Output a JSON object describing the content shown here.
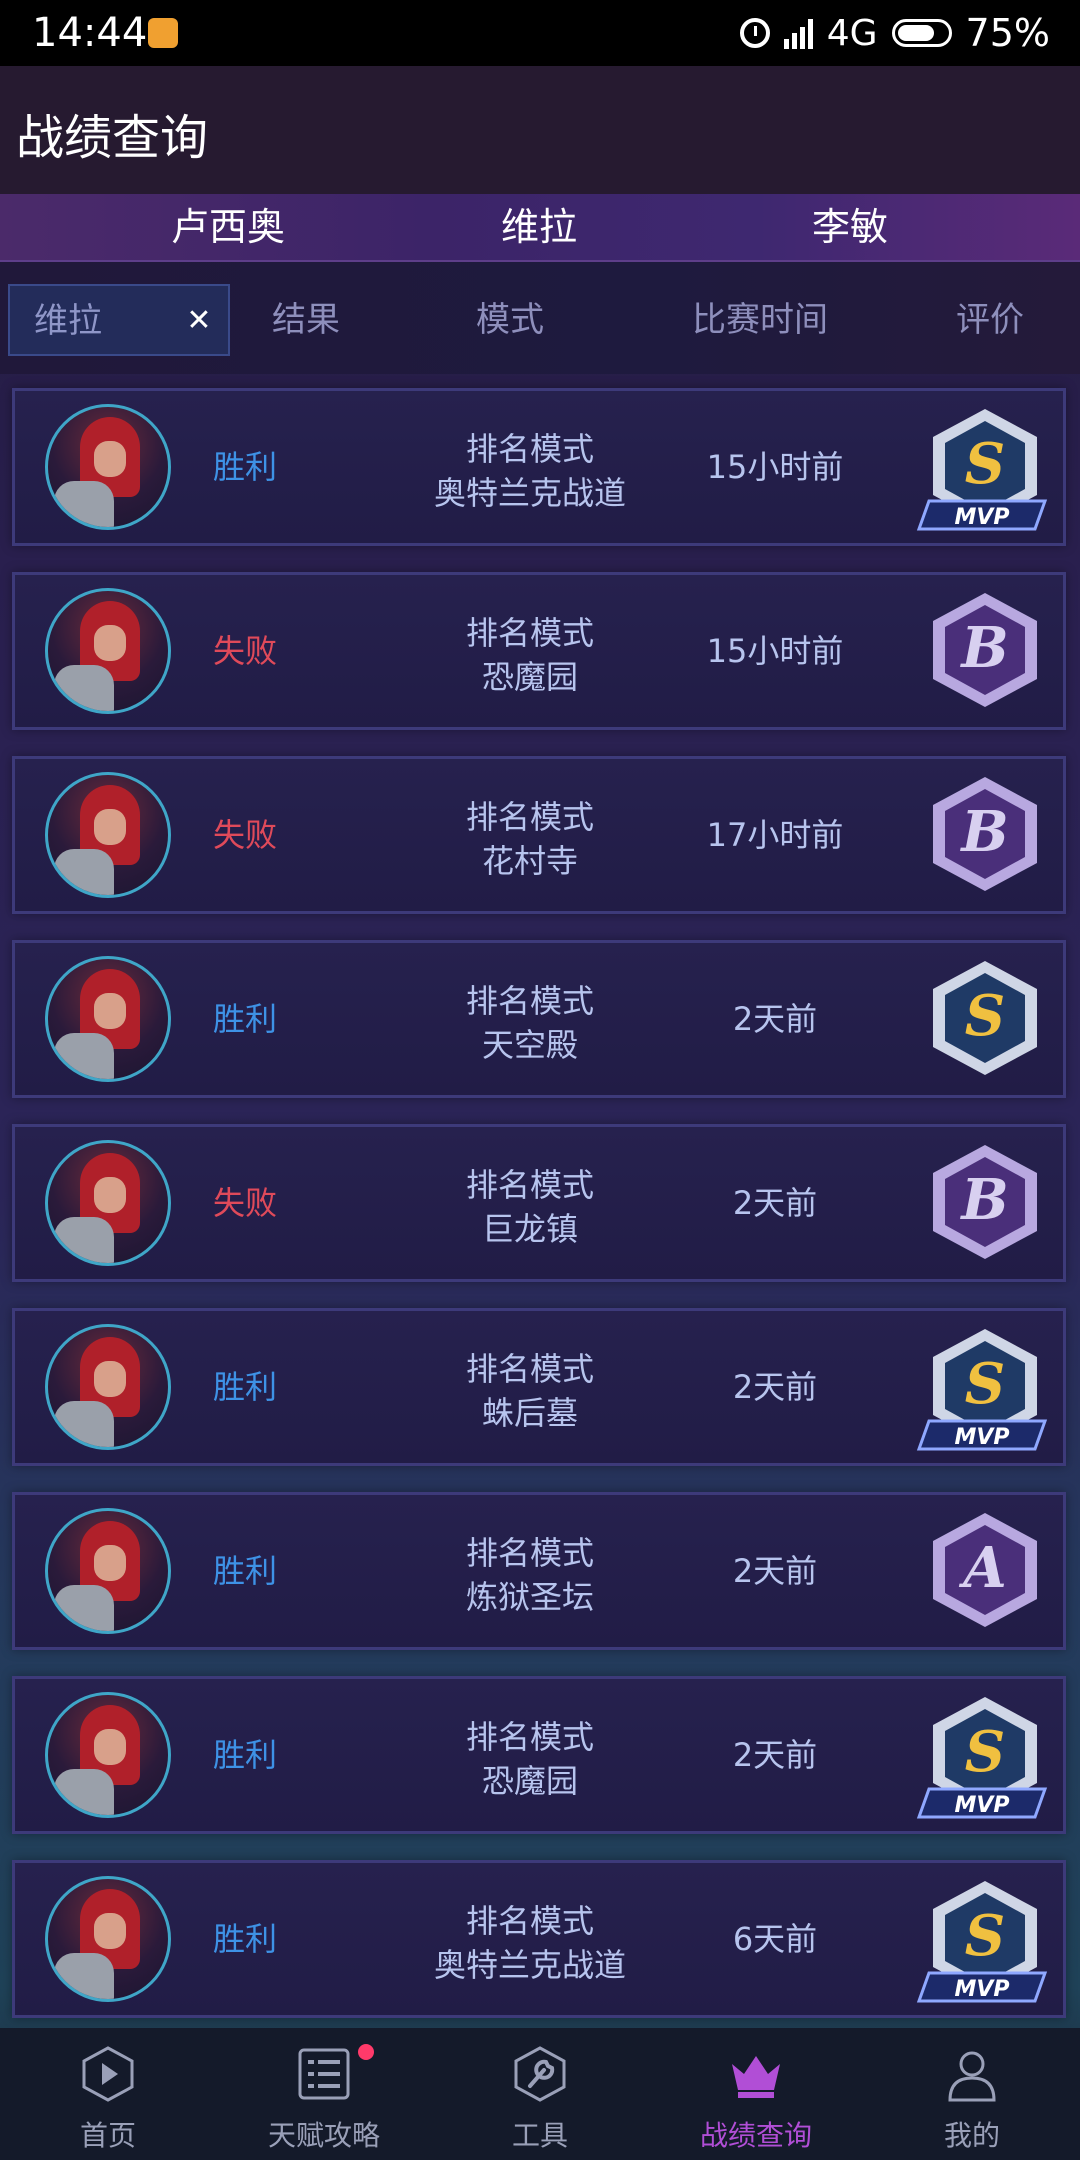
{
  "status_bar": {
    "time": "14:44",
    "network": "4G",
    "battery": "75%"
  },
  "header": {
    "title": "战绩查询"
  },
  "hero_tabs": [
    {
      "label": "卢西奥"
    },
    {
      "label": "维拉"
    },
    {
      "label": "李敏"
    }
  ],
  "filter": {
    "hero_select": "维拉",
    "columns": [
      "结果",
      "模式",
      "比赛时间",
      "评价"
    ]
  },
  "matches": [
    {
      "result": "胜利",
      "outcome": "win",
      "mode": "排名模式",
      "map": "奥特兰克战道",
      "time": "15小时前",
      "grade": "S",
      "mvp": "MVP"
    },
    {
      "result": "失败",
      "outcome": "loss",
      "mode": "排名模式",
      "map": "恐魔园",
      "time": "15小时前",
      "grade": "B",
      "mvp": ""
    },
    {
      "result": "失败",
      "outcome": "loss",
      "mode": "排名模式",
      "map": "花村寺",
      "time": "17小时前",
      "grade": "B",
      "mvp": ""
    },
    {
      "result": "胜利",
      "outcome": "win",
      "mode": "排名模式",
      "map": "天空殿",
      "time": "2天前",
      "grade": "S",
      "mvp": ""
    },
    {
      "result": "失败",
      "outcome": "loss",
      "mode": "排名模式",
      "map": "巨龙镇",
      "time": "2天前",
      "grade": "B",
      "mvp": ""
    },
    {
      "result": "胜利",
      "outcome": "win",
      "mode": "排名模式",
      "map": "蛛后墓",
      "time": "2天前",
      "grade": "S",
      "mvp": "MVP"
    },
    {
      "result": "胜利",
      "outcome": "win",
      "mode": "排名模式",
      "map": "炼狱圣坛",
      "time": "2天前",
      "grade": "A",
      "mvp": ""
    },
    {
      "result": "胜利",
      "outcome": "win",
      "mode": "排名模式",
      "map": "恐魔园",
      "time": "2天前",
      "grade": "S",
      "mvp": "MVP"
    },
    {
      "result": "胜利",
      "outcome": "win",
      "mode": "排名模式",
      "map": "奥特兰克战道",
      "time": "6天前",
      "grade": "S",
      "mvp": "MVP"
    }
  ],
  "bottom_nav": [
    {
      "label": "首页",
      "icon": "play-icon"
    },
    {
      "label": "天赋攻略",
      "icon": "list-icon",
      "badge": true
    },
    {
      "label": "工具",
      "icon": "wrench-icon"
    },
    {
      "label": "战绩查询",
      "icon": "crown-icon",
      "active": true
    },
    {
      "label": "我的",
      "icon": "user-icon"
    }
  ],
  "colors": {
    "win": "#3e92e6",
    "loss": "#e04a5a",
    "active_nav": "#b14ed6"
  }
}
